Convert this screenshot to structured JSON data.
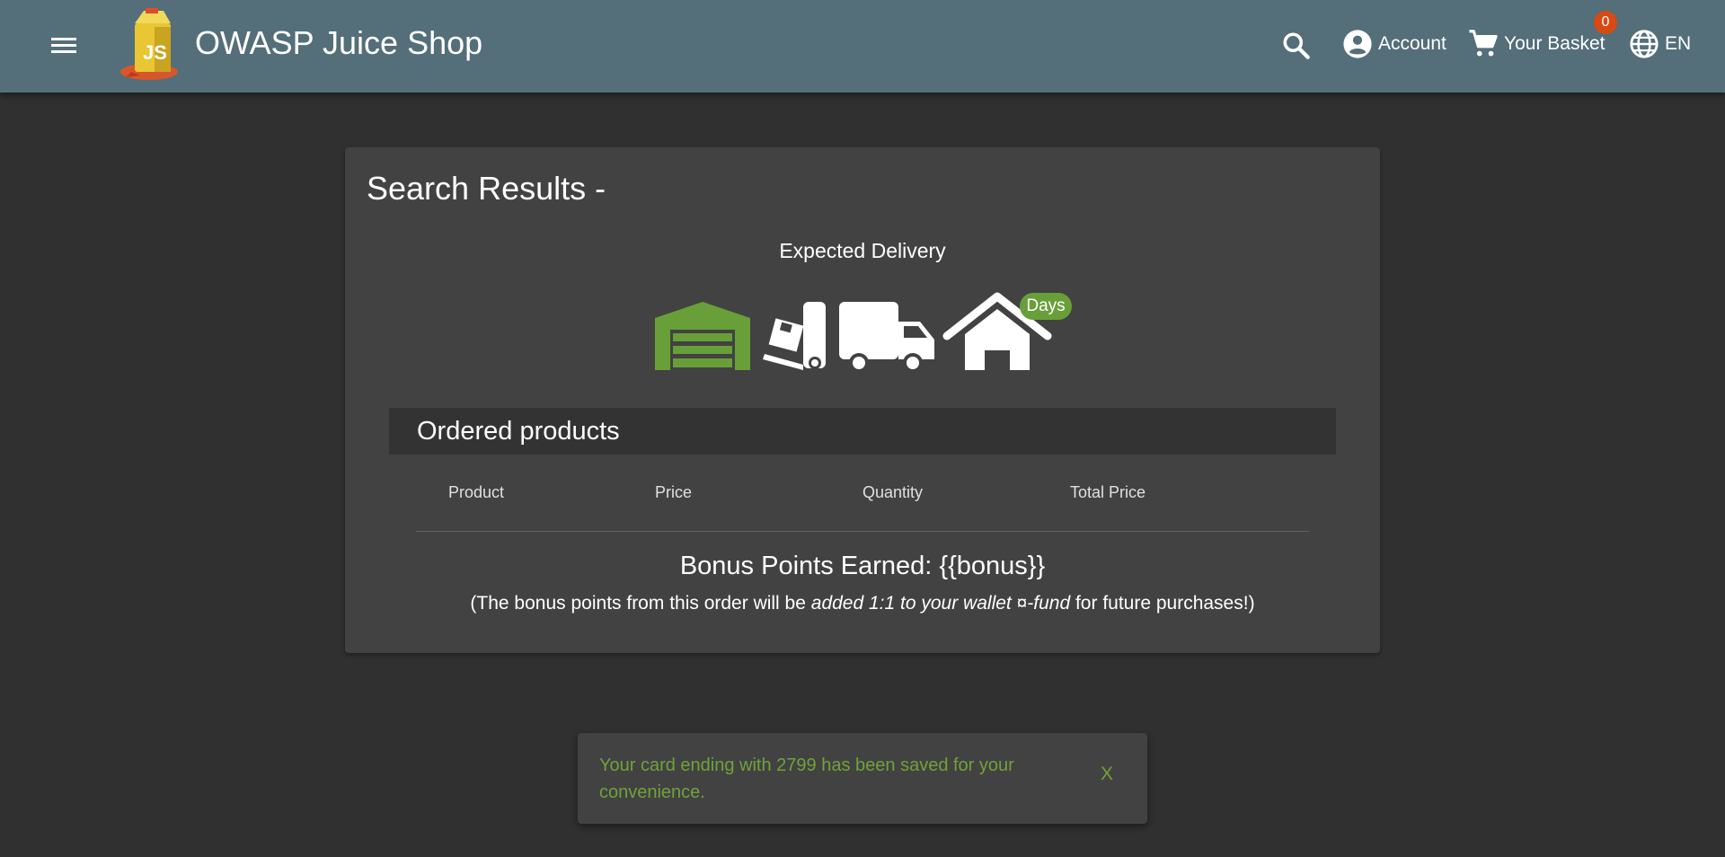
{
  "header": {
    "app_title": "OWASP Juice Shop",
    "account_label": "Account",
    "basket_label": "Your Basket",
    "basket_count": "0",
    "language_label": "EN"
  },
  "card": {
    "title": "Search Results -",
    "delivery_label": "Expected Delivery",
    "days_label": "Days",
    "orders_header": "Ordered products",
    "columns": [
      "Product",
      "Price",
      "Quantity",
      "Total Price"
    ],
    "bonus_title": "Bonus Points Earned: {{bonus}}",
    "bonus_note_pre": "(The bonus points from this order will be ",
    "bonus_note_em1": "added 1:1 to your wallet",
    "bonus_note_mid": " ¤",
    "bonus_note_em2": "-fund",
    "bonus_note_post": " for future purchases!)"
  },
  "snackbar": {
    "message": "Your card ending with 2799 has been saved for your convenience.",
    "close_label": "X"
  },
  "colors": {
    "toolbar": "#546e7a",
    "background": "#303030",
    "card": "#424242",
    "accent_green": "#689f38",
    "badge": "#d84a13"
  },
  "icons": [
    "menu-icon",
    "juice-shop-logo",
    "search-icon",
    "account-circle-icon",
    "cart-icon",
    "globe-icon",
    "warehouse-icon",
    "dolly-icon",
    "truck-icon",
    "home-icon"
  ]
}
